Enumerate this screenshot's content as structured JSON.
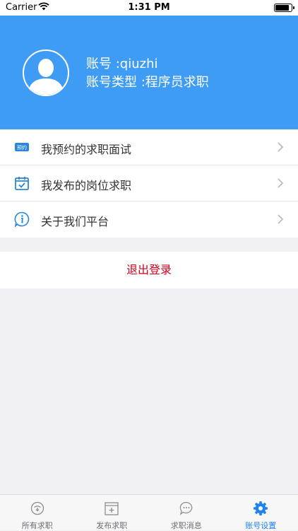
{
  "status_bar": {
    "carrier": "Carrier",
    "time": "1:31 PM",
    "battery_level": 0.9
  },
  "profile": {
    "account_line": "账号 :qiuzhi",
    "account_type_line": "账号类型 :程序员求职"
  },
  "menu": {
    "items": [
      {
        "label": "我预约的求职面试",
        "icon": "appointment-icon",
        "icon_text": "预约"
      },
      {
        "label": "我发布的岗位求职",
        "icon": "calendar-check-icon"
      },
      {
        "label": "关于我们平台",
        "icon": "info-icon"
      }
    ]
  },
  "logout": {
    "label": "退出登录"
  },
  "tabbar": {
    "items": [
      {
        "label": "所有求职",
        "icon": "all-jobs-icon",
        "active": false
      },
      {
        "label": "发布求职",
        "icon": "post-job-icon",
        "active": false
      },
      {
        "label": "求职消息",
        "icon": "message-icon",
        "active": false
      },
      {
        "label": "账号设置",
        "icon": "gear-icon",
        "active": true
      }
    ]
  },
  "colors": {
    "header": "#3F9CF5",
    "accent": "#1E82F0",
    "logout": "#D0021B",
    "background": "#EFEFF4"
  }
}
